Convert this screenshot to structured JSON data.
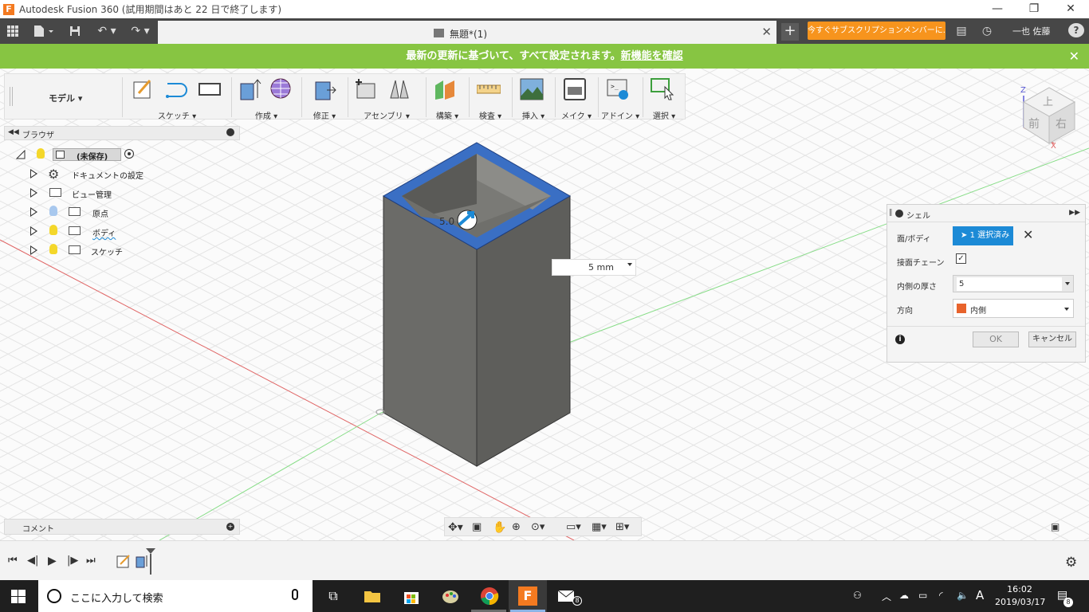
{
  "window": {
    "title": "Autodesk Fusion 360 (試用期間はあと 22 日で終了します)",
    "app_icon": "F"
  },
  "tabbar": {
    "doc_tab": "無題*(1)",
    "subscription_button": "今すぐサブスクリプションメンバーに...",
    "user_name": "一也 佐藤",
    "help": "?"
  },
  "banner": {
    "text": "最新の更新に基づいて、すべて設定されます。",
    "link": "新機能を確認",
    "color": "#87c542"
  },
  "toolbar": {
    "mode": "モデル",
    "groups": [
      "スケッチ",
      "作成",
      "修正",
      "アセンブリ",
      "構築",
      "検査",
      "挿入",
      "メイク",
      "アドイン",
      "選択"
    ]
  },
  "browser": {
    "title": "ブラウザ",
    "root": "(未保存)",
    "items": [
      "ドキュメントの設定",
      "ビュー管理",
      "原点",
      "ボディ",
      "スケッチ"
    ]
  },
  "comment": {
    "title": "コメント"
  },
  "viewport": {
    "dimension_value": "5 mm",
    "body_color": "#6b6b68",
    "selected_face_color": "#3a6fc4",
    "overlay_label": "5.0"
  },
  "shell_dialog": {
    "title": "シェル",
    "face_body_label": "面/ボディ",
    "selected": "1 選択済み",
    "tangent_chain_label": "接面チェーン",
    "tangent_chain_checked": true,
    "inside_thickness_label": "内側の厚さ",
    "inside_thickness_value": "5",
    "direction_label": "方向",
    "direction_value": "内側",
    "ok": "OK",
    "cancel": "キャンセル",
    "accent": "#1c8ad6"
  },
  "viewcube": {
    "top": "上",
    "front": "前",
    "right": "右",
    "axis_x": "X",
    "axis_z": "Z"
  },
  "taskbar": {
    "search_placeholder": "ここに入力して検索",
    "time": "16:02",
    "date": "2019/03/17",
    "ime": "A",
    "notification_count": "8",
    "mail_badge": "8"
  }
}
